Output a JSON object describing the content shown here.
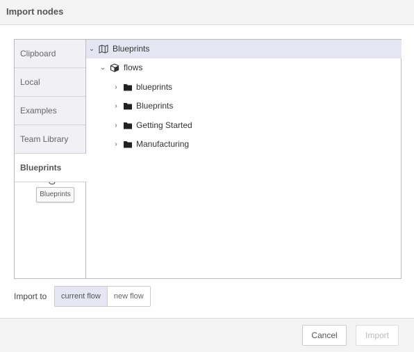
{
  "dialog": {
    "title": "Import nodes"
  },
  "tabs": [
    {
      "label": "Clipboard"
    },
    {
      "label": "Local"
    },
    {
      "label": "Examples"
    },
    {
      "label": "Team Library"
    },
    {
      "label": "Blueprints",
      "active": true
    }
  ],
  "tooltip": {
    "text": "Blueprints"
  },
  "tree": {
    "root": {
      "label": "Blueprints",
      "icon": "map-icon",
      "expanded": true
    },
    "child": {
      "label": "flows",
      "icon": "cube-icon",
      "expanded": true
    },
    "folders": [
      {
        "label": "blueprints",
        "icon": "folder-icon"
      },
      {
        "label": "Blueprints",
        "icon": "folder-icon"
      },
      {
        "label": "Getting Started",
        "icon": "folder-icon"
      },
      {
        "label": "Manufacturing",
        "icon": "folder-icon"
      }
    ]
  },
  "import_to": {
    "label": "Import to",
    "options": [
      {
        "label": "current flow",
        "selected": true
      },
      {
        "label": "new flow",
        "selected": false
      }
    ]
  },
  "footer": {
    "cancel_label": "Cancel",
    "import_label": "Import"
  },
  "colors": {
    "selected_bg": "#e6e6f2",
    "tab_bg": "#f0f0f5",
    "border": "#bbbbbb"
  }
}
